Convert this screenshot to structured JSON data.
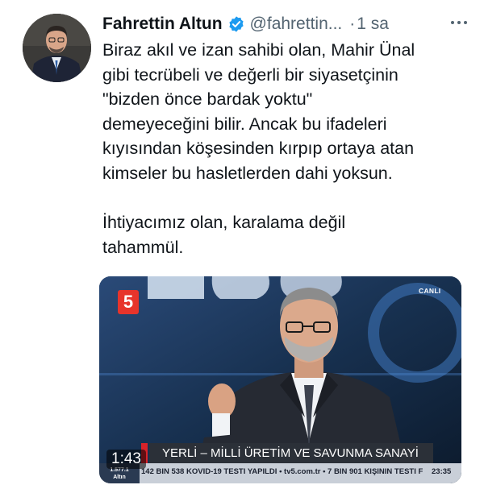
{
  "tweet": {
    "author_name": "Fahrettin Altun",
    "handle": "@fahrettin...",
    "separator": "·",
    "time": "1 sa",
    "more_icon": "more-horizontal-icon",
    "verified_icon": "verified-badge-icon",
    "lines": [
      "Biraz akıl ve izan sahibi olan, Mahir Ünal",
      "gibi tecrübeli ve değerli bir siyasetçinin",
      "\"bizden önce bardak yoktu\"",
      "demeyeceğini bilir. Ancak bu ifadeleri",
      "kıyısından köşesinden kırpıp ortaya atan",
      "kimseler bu hasletlerden dahi yoksun."
    ],
    "lines2": [
      "İhtiyacımız olan, karalama değil",
      "tahammül."
    ]
  },
  "media": {
    "channel_logo": "5",
    "live_label": "CANLI",
    "banner_text": "YERLİ – MİLLİ ÜRETİM VE SAVUNMA SANAYİ",
    "ticker_text": "142 BIN 538 KOVID-19 TESTI YAPILDI  • tv5.com.tr  •  7 BIN 901 KIŞININ TESTI F",
    "ticker_time": "23:35",
    "ticker_brand_top": "1.577.1",
    "ticker_brand_bottom": "Altın",
    "duration": "1:43"
  },
  "colors": {
    "text": "#0f1419",
    "muted": "#536471",
    "verified": "#1d9bf0",
    "channel_red": "#e7342b"
  }
}
